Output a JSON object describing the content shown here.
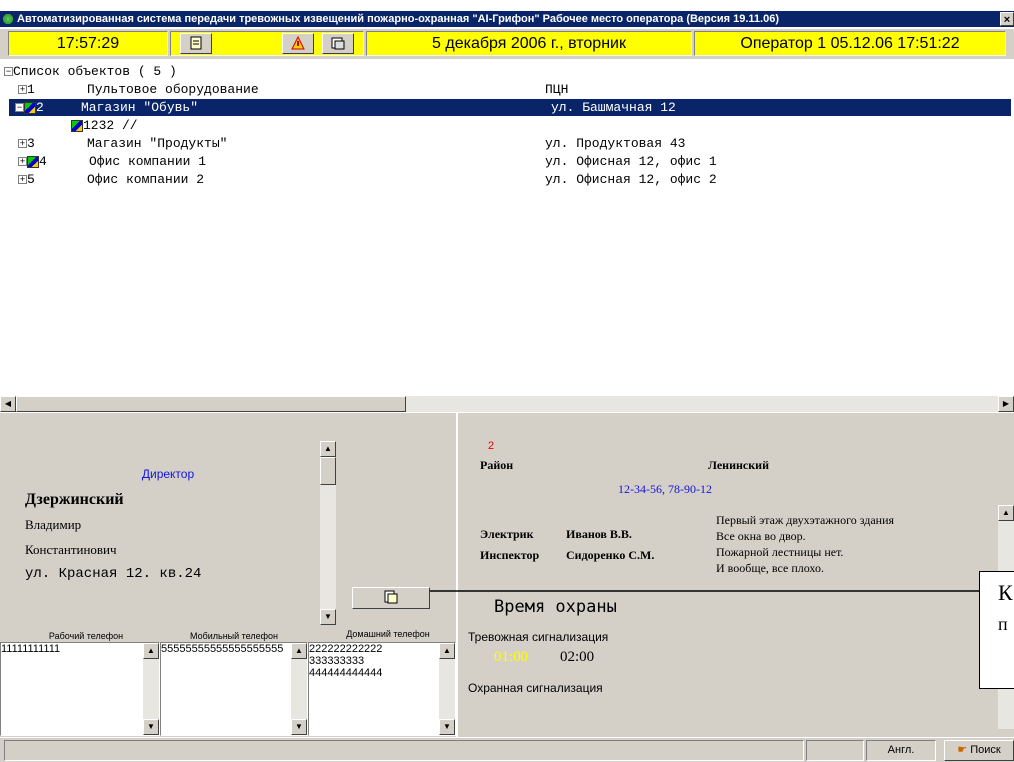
{
  "title_bar": {
    "text": "Автоматизированная система передачи тревожных извещений пожарно-охранная \"AI-Грифон\" Рабочее место оператора (Версия 19.11.06)",
    "close": "×"
  },
  "toolbar": {
    "time": "17:57:29",
    "date": "5 декабря 2006 г., вторник",
    "operator": "Оператор 1  05.12.06 17:51:22",
    "accent": "#ffff00"
  },
  "tree": {
    "root": "Список объектов ( 5 )",
    "items": [
      {
        "num": "1",
        "name": "Пультовое оборудование",
        "address": "ПЦН"
      },
      {
        "num": "2",
        "name": "Магазин \"Обувь\"",
        "address": "ул. Башмачная 12"
      },
      {
        "num": "1232 //",
        "name": "",
        "address": ""
      },
      {
        "num": "3",
        "name": "Магазин \"Продукты\"",
        "address": "ул. Продуктовая 43"
      },
      {
        "num": "4",
        "name": "Офис компании 1",
        "address": "ул. Офисная 12, офис 1"
      },
      {
        "num": "5",
        "name": "Офис компании 2",
        "address": "ул. Офисная 12, офис 2"
      }
    ],
    "selected_color": "#0a246a"
  },
  "contact": {
    "position": "Директор",
    "surname": "Дзержинский",
    "name": "Владимир",
    "patronymic": "Константинович",
    "address": "ул. Красная 12. кв.24"
  },
  "phones": {
    "work_label": "Рабочий телефон",
    "mobile_label": "Мобильный телефон",
    "home_label": "Домашний телефон",
    "work": "11111111111",
    "mobile": "55555555555555555555",
    "home_lines": [
      "222222222222",
      "333333333",
      "444444444444"
    ]
  },
  "details": {
    "object_num": "2",
    "district_label": "Район",
    "district": "Ленинский",
    "phones": "12-34-56, 78-90-12",
    "electrician_label": "Электрик",
    "electrician": "Иванов В.В.",
    "inspector_label": "Инспектор",
    "inspector": "Сидоренко С.М.",
    "notes": [
      "Первый этаж двухэтажного здания",
      "Все окна во двор.",
      "Пожарной лестницы нет.",
      "И вообще, все плохо."
    ],
    "guard_time_label": "Время охраны",
    "alarm_label": "Тревожная сигнализация",
    "alarm_from": "01:00",
    "alarm_to": "02:00",
    "security_label": "Охранная сигнализация"
  },
  "callout": {
    "lines": [
      "К",
      "п"
    ]
  },
  "status": {
    "lang": "Англ.",
    "search": "Поиск"
  }
}
